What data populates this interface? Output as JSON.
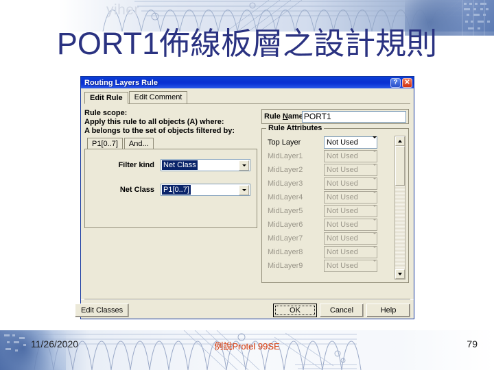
{
  "slide": {
    "title": "PORT1佈線板層之設計規則",
    "watermark": "yiher",
    "title_color": "#2a3281"
  },
  "footer": {
    "date": "11/26/2020",
    "center_primary": "例說Protel 99SE",
    "center_overlay": "例說Protel 99SE",
    "page_number": "79",
    "center_color": "#d6491f"
  },
  "dialog": {
    "title": "Routing Layers Rule",
    "titlebar_color": "#0a2fd0",
    "help_button": "?",
    "close_button": "✕",
    "tabs": [
      {
        "label": "Edit Rule",
        "active": true
      },
      {
        "label": "Edit Comment",
        "active": false
      }
    ],
    "scope": {
      "heading": "Rule scope:",
      "line2": "Apply this rule to all objects (A) where:",
      "line3": "A belongs to the set of objects filtered by:",
      "inner_tabs": [
        {
          "label": "P1[0..7]",
          "active": true
        },
        {
          "label": "And...",
          "active": false
        }
      ],
      "fields": [
        {
          "label": "Filter kind",
          "value": "Net Class",
          "selected": true
        },
        {
          "label": "Net Class",
          "value": "P1[0..7]",
          "selected": true
        }
      ]
    },
    "rule_name": {
      "label_pre": "Rule ",
      "label_key": "N",
      "label_post": "ame",
      "value": "PORT1"
    },
    "attributes": {
      "group_title": "Rule Attributes",
      "rows": [
        {
          "label": "Top Layer",
          "value": "Not Used",
          "enabled": true
        },
        {
          "label": "MidLayer1",
          "value": "Not Used",
          "enabled": false
        },
        {
          "label": "MidLayer2",
          "value": "Not Used",
          "enabled": false
        },
        {
          "label": "MidLayer3",
          "value": "Not Used",
          "enabled": false
        },
        {
          "label": "MidLayer4",
          "value": "Not Used",
          "enabled": false
        },
        {
          "label": "MidLayer5",
          "value": "Not Used",
          "enabled": false
        },
        {
          "label": "MidLayer6",
          "value": "Not Used",
          "enabled": false
        },
        {
          "label": "MidLayer7",
          "value": "Not Used",
          "enabled": false
        },
        {
          "label": "MidLayer8",
          "value": "Not Used",
          "enabled": false
        },
        {
          "label": "MidLayer9",
          "value": "Not Used",
          "enabled": false
        }
      ]
    },
    "buttons": {
      "edit_classes": "Edit Classes",
      "ok": "OK",
      "cancel": "Cancel",
      "help": "Help"
    }
  }
}
